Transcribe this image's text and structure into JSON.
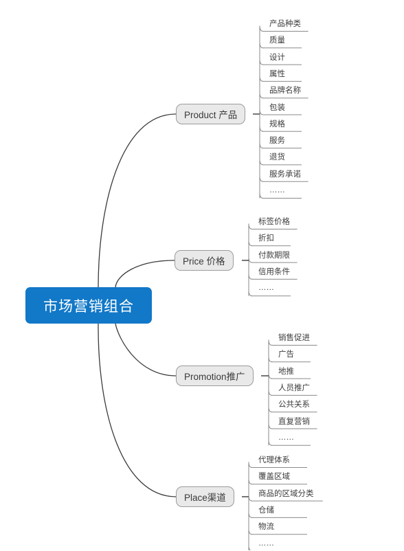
{
  "diagram": {
    "type": "mind-map",
    "title": "市场营销组合",
    "root": {
      "label": "市场营销组合",
      "color": "#1278c8",
      "text_color": "#ffffff"
    },
    "branch_style": {
      "fill": "#e9e9e9",
      "border": "#9b9b9b",
      "text_color": "#3a3a3a"
    },
    "connector_color": "#3a3a3a",
    "leaf_line_color": "#8a8a8a",
    "branches": [
      {
        "label": "Product 产品",
        "leaves": [
          "产品种类",
          "质量",
          "设计",
          "属性",
          "品牌名称",
          "包装",
          "规格",
          "服务",
          "退货",
          "服务承诺",
          "……"
        ]
      },
      {
        "label": "Price 价格",
        "leaves": [
          "标签价格",
          "折扣",
          "付款期限",
          "信用条件",
          "……"
        ]
      },
      {
        "label": "Promotion推广",
        "leaves": [
          "销售促进",
          "广告",
          "地推",
          "人员推广",
          "公共关系",
          "直复营销",
          "……"
        ]
      },
      {
        "label": "Place渠道",
        "leaves": [
          "代理体系",
          "覆盖区域",
          "商品的区域分类",
          "仓储",
          "物流",
          "……"
        ]
      }
    ]
  }
}
